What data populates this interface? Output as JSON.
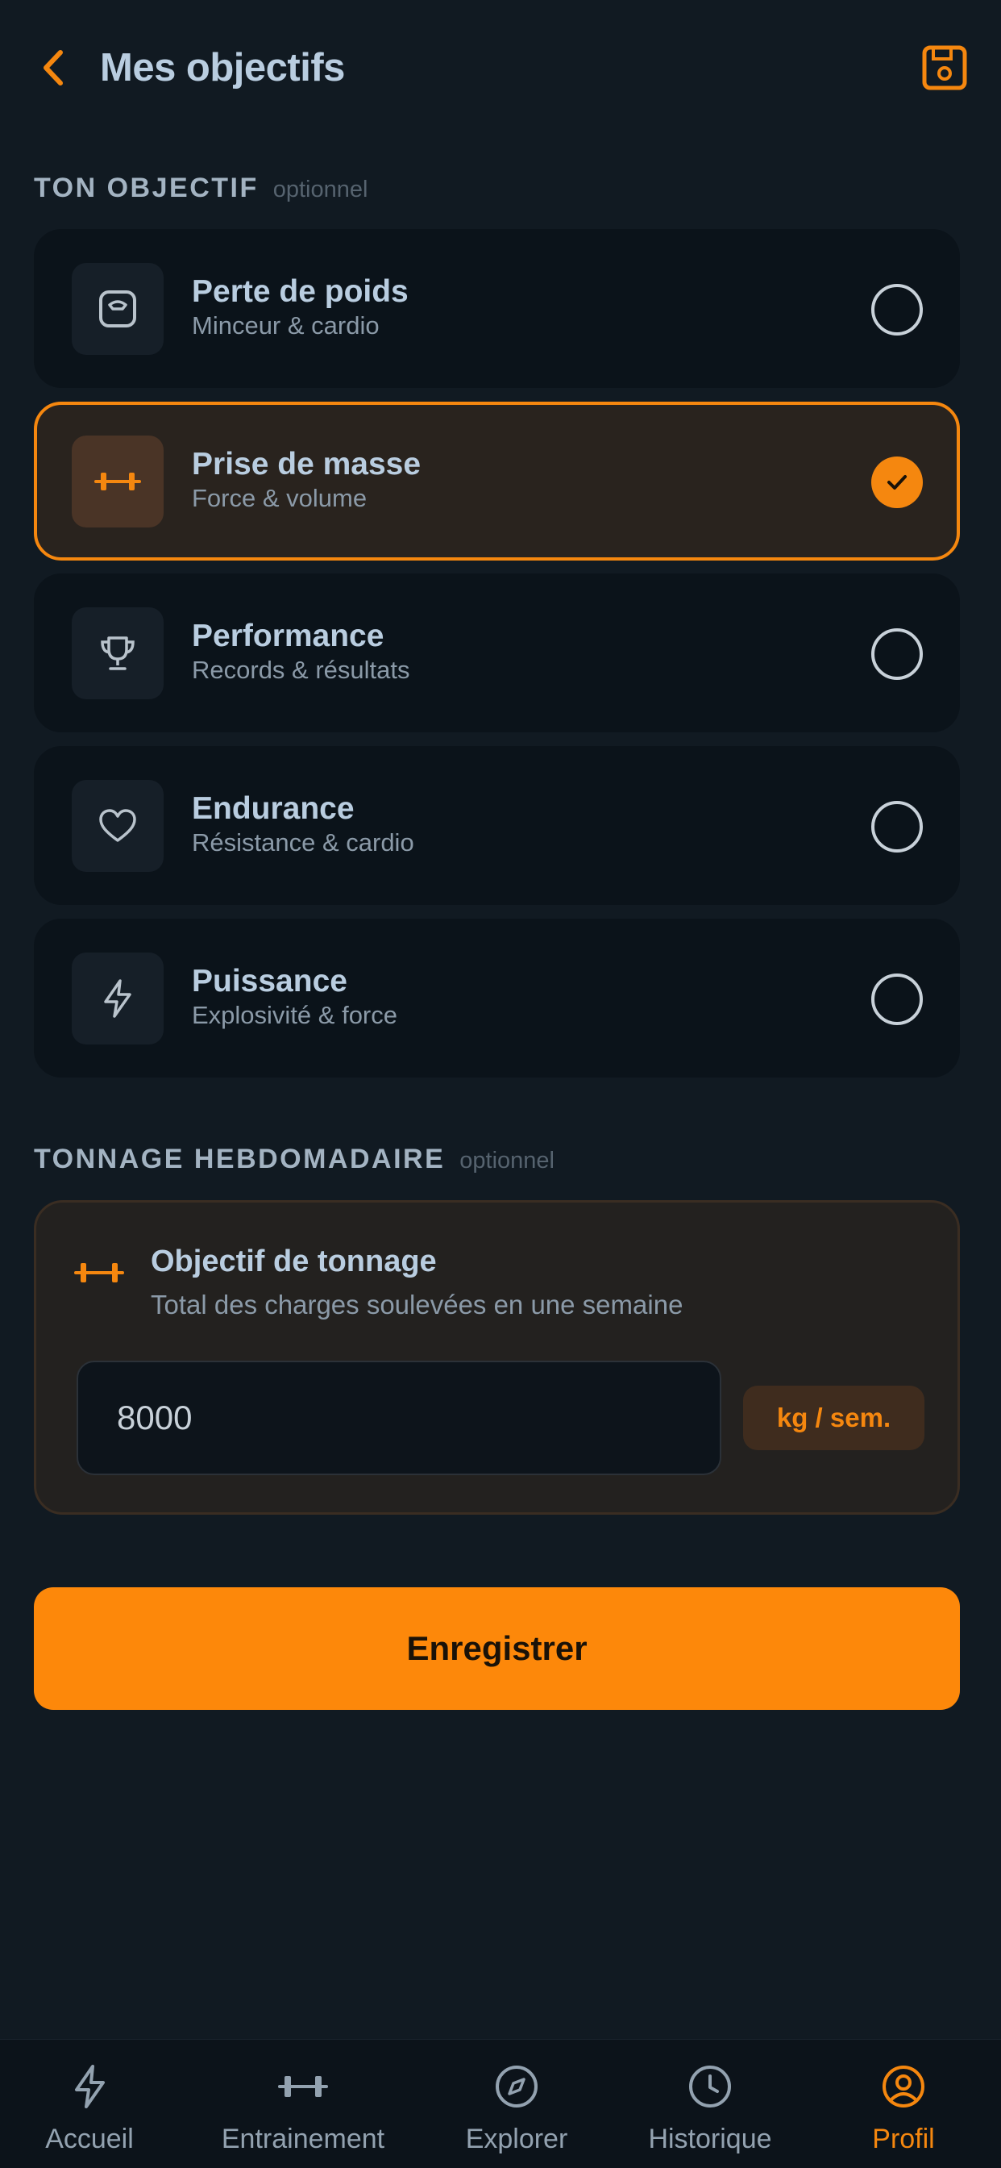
{
  "header": {
    "title": "Mes objectifs",
    "back_icon": "chevron-left-icon",
    "save_icon": "floppy-disk-icon"
  },
  "goal_section": {
    "label": "TON OBJECTIF",
    "optional": "optionnel"
  },
  "goals": [
    {
      "title": "Perte de poids",
      "subtitle": "Minceur & cardio",
      "icon": "scale-icon",
      "selected": false
    },
    {
      "title": "Prise de masse",
      "subtitle": "Force & volume",
      "icon": "dumbbell-icon",
      "selected": true
    },
    {
      "title": "Performance",
      "subtitle": "Records & résultats",
      "icon": "trophy-icon",
      "selected": false
    },
    {
      "title": "Endurance",
      "subtitle": "Résistance & cardio",
      "icon": "heart-icon",
      "selected": false
    },
    {
      "title": "Puissance",
      "subtitle": "Explosivité & force",
      "icon": "lightning-icon",
      "selected": false
    }
  ],
  "tonnage_section": {
    "label": "TONNAGE HEBDOMADAIRE",
    "optional": "optionnel"
  },
  "tonnage": {
    "title": "Objectif de tonnage",
    "description": "Total des charges soulevées en une semaine",
    "value": "8000",
    "unit": "kg / sem."
  },
  "save_button": {
    "label": "Enregistrer"
  },
  "nav": [
    {
      "label": "Accueil",
      "icon": "lightning-icon",
      "active": false
    },
    {
      "label": "Entrainement",
      "icon": "dumbbell-icon",
      "active": false
    },
    {
      "label": "Explorer",
      "icon": "compass-icon",
      "active": false
    },
    {
      "label": "Historique",
      "icon": "clock-icon",
      "active": false
    },
    {
      "label": "Profil",
      "icon": "user-circle-icon",
      "active": true
    }
  ],
  "colors": {
    "accent": "#fd880a",
    "background": "#111a22",
    "card": "#0b131a",
    "selected_card": "#29231e",
    "text_primary": "#b9cde0",
    "text_secondary": "#8b9aa8"
  }
}
